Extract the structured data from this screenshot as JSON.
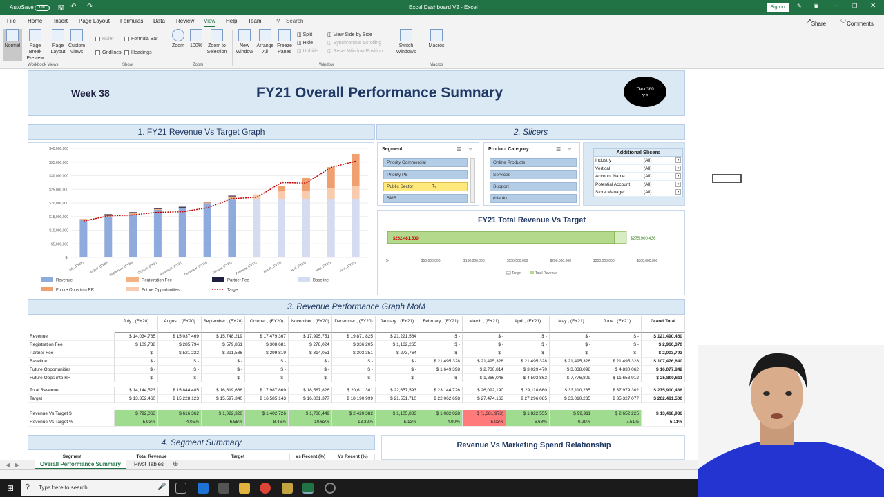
{
  "window": {
    "title": "Excel Dashboard V2 - Excel",
    "autosave": "AutoSave",
    "toggle": "Off",
    "sign_in": "Sign in"
  },
  "menu": {
    "items": [
      "File",
      "Home",
      "Insert",
      "Page Layout",
      "Formulas",
      "Data",
      "Review",
      "View",
      "Help",
      "Team"
    ],
    "search": "Search",
    "share": "Share",
    "comments": "Comments"
  },
  "ribbon": {
    "wb_views": [
      "Normal",
      "Page Break Preview",
      "Page Layout",
      "Custom Views"
    ],
    "show": [
      "Ruler",
      "Formula Bar",
      "Gridlines",
      "Headings"
    ],
    "zoom": [
      "Zoom",
      "100%",
      "Zoom to Selection"
    ],
    "window": [
      "New Window",
      "Arrange All",
      "Freeze Panes"
    ],
    "window_small": [
      "Split",
      "Hide",
      "Unhide"
    ],
    "compare": [
      "View Side by Side",
      "Synchronous Scrolling",
      "Reset Window Position"
    ],
    "switch": "Switch Windows",
    "macros": "Macros",
    "groups": [
      "Workbook Views",
      "Show",
      "Zoom",
      "Window",
      "Macros"
    ]
  },
  "dashboard": {
    "week": "Week 38",
    "title": "FY21 Overall Performance Sumnary",
    "logo_line1": "Data 360",
    "logo_line2": "YP",
    "sec1": "1. FY21 Revenue Vs Target Graph",
    "sec2": "2. Slicers",
    "sec3": "3. Revenue Performance Graph MoM",
    "sec4": "4. Segment Summary",
    "sec5": "Revenue Vs  Marketing Spend Relationship"
  },
  "chart_data": {
    "type": "bar",
    "categories": [
      "July, (FY20)",
      "August, (FY20)",
      "September, (FY20)",
      "October, (FY20)",
      "November, (FY20)",
      "December, (FY20)",
      "January, (FY21)",
      "February, (FY21)",
      "March, (FY21)",
      "April, (FY21)",
      "May, (FY21)",
      "June, (FY21)"
    ],
    "ylim": [
      0,
      40000000
    ],
    "yticks": [
      "$-",
      "$5,000,000",
      "$10,000,000",
      "$15,000,000",
      "$20,000,000",
      "$25,000,000",
      "$30,000,000",
      "$35,000,000",
      "$40,000,000"
    ],
    "series": [
      {
        "name": "Revenue",
        "color": "#8faadc",
        "values": [
          14034785,
          15037469,
          15748219,
          17479367,
          17995751,
          19871825,
          21221564,
          0,
          0,
          0,
          0,
          0
        ]
      },
      {
        "name": "Registration Fee",
        "color": "#f4b183",
        "values": [
          109738,
          285794,
          579861,
          308681,
          278024,
          336205,
          1162265,
          0,
          0,
          0,
          0,
          0
        ]
      },
      {
        "name": "Partner Fee",
        "color": "#1f1f3f",
        "values": [
          0,
          521222,
          291586,
          299819,
          314051,
          303351,
          273764,
          0,
          0,
          0,
          0,
          0
        ]
      },
      {
        "name": "Baseline",
        "color": "#d6dcf0",
        "values": [
          0,
          0,
          0,
          0,
          0,
          0,
          0,
          21495328,
          21495328,
          21495328,
          21495328,
          21495328
        ]
      },
      {
        "name": "Future Opportunities",
        "color": "#f8cbad",
        "values": [
          0,
          0,
          0,
          0,
          0,
          0,
          0,
          1649398,
          2730814,
          3029470,
          3838098,
          4830062
        ]
      },
      {
        "name": "Future Opps into RR",
        "color": "#f0a070",
        "values": [
          0,
          0,
          0,
          0,
          0,
          0,
          0,
          0,
          1866048,
          4593862,
          7776809,
          11653912
        ]
      },
      {
        "name": "Target",
        "color": "#c00000",
        "values": [
          13352460,
          15228123,
          15597340,
          16585143,
          16801377,
          18190999,
          21551710,
          22062698,
          27474163,
          27296085,
          33010235,
          35327077
        ]
      }
    ],
    "legend": [
      "Revenue",
      "Registration Fee",
      "Partner Fee",
      "Baseline",
      "Future Opps into RR",
      "Future Opportunities",
      "Target"
    ]
  },
  "slicers": {
    "segment": {
      "title": "Segment",
      "items": [
        "Priority Commercial",
        "Priority PS",
        "Public Sector",
        "SMB"
      ],
      "selected": 2
    },
    "product": {
      "title": "Product Category",
      "items": [
        "Online Products",
        "Services",
        "Support",
        "(blank)"
      ]
    },
    "additional": {
      "title": "Additional Slicers",
      "rows": [
        [
          "Industry",
          "(All)"
        ],
        [
          "Vertical",
          "(All)"
        ],
        [
          "Account Name",
          "(All)"
        ],
        [
          "Potential Account",
          "(All)"
        ],
        [
          "Store Manager",
          "(All)"
        ]
      ]
    }
  },
  "totalchart": {
    "title": "FY21 Total Revenue Vs Target",
    "bar_label": "$262,481,500",
    "target_label": "$275,900,436",
    "value": 262481500,
    "target": 275900436,
    "ticks": [
      "$-",
      "$50,000,000",
      "$100,000,000",
      "$150,000,000",
      "$200,000,000",
      "$250,000,000",
      "$300,000,000"
    ],
    "legend": [
      "Target",
      "Total Revenue"
    ]
  },
  "table": {
    "headers": [
      "July , (FY20)",
      "August , (FY20)",
      "September , (FY20)",
      "October , (FY20)",
      "November , (FY20)",
      "December , (FY20)",
      "January , (FY21)",
      "February , (FY21)",
      "March , (FY21)",
      "April , (FY21)",
      "May , (FY21)",
      "June , (FY21)",
      "Grand Total"
    ],
    "rows1": [
      [
        "Revenue",
        "$ 14,034,785",
        "$ 15,037,469",
        "$ 15,748,219",
        "$ 17,479,367",
        "$ 17,995,751",
        "$ 19,871,825",
        "$ 21,221,564",
        "$ -",
        "$ -",
        "$ -",
        "$ -",
        "$ -",
        "$ 121,490,460"
      ],
      [
        "Registration Fee",
        "$ 109,738",
        "$ 285,794",
        "$ 579,861",
        "$ 308,681",
        "$ 278,024",
        "$ 336,205",
        "$ 1,162,265",
        "$ -",
        "$ -",
        "$ -",
        "$ -",
        "$ -",
        "$ 2,960,370"
      ],
      [
        "Partner Fee",
        "$ -",
        "$ 521,222",
        "$ 291,586",
        "$ 299,819",
        "$ 314,051",
        "$ 303,351",
        "$ 273,764",
        "$ -",
        "$ -",
        "$ -",
        "$ -",
        "$ -",
        "$ 2,003,793"
      ],
      [
        "Baseline",
        "$ -",
        "$ -",
        "$ -",
        "$ -",
        "$ -",
        "$ -",
        "$ -",
        "$ 21,495,328",
        "$ 21,495,328",
        "$ 21,495,328",
        "$ 21,495,328",
        "$ 21,495,328",
        "$ 107,476,640"
      ],
      [
        "Future Opportunities",
        "$ -",
        "$ -",
        "$ -",
        "$ -",
        "$ -",
        "$ -",
        "$ -",
        "$ 1,649,398",
        "$ 2,730,814",
        "$ 3,029,470",
        "$ 3,838,098",
        "$ 4,830,062",
        "$ 16,077,842"
      ],
      [
        "Future Opps into RR",
        "$ -",
        "$ -",
        "$ -",
        "$ -",
        "$ -",
        "$ -",
        "$ -",
        "$ -",
        "$ 1,866,048",
        "$ 4,593,862",
        "$ 7,776,809",
        "$ 11,653,912",
        "$ 25,890,611"
      ]
    ],
    "rows2": [
      [
        "Total Revenue",
        "$ 14,144,523",
        "$ 15,844,485",
        "$ 16,619,666",
        "$ 17,987,869",
        "$ 18,587,826",
        "$ 20,611,381",
        "$ 22,657,593",
        "$ 23,144,726",
        "$ 26,092,190",
        "$ 29,118,660",
        "$ 33,110,235",
        "$ 37,979,302",
        "$ 275,900,436"
      ],
      [
        "Target",
        "$ 13,352,460",
        "$ 15,228,123",
        "$ 15,597,340",
        "$ 16,585,143",
        "$ 16,801,377",
        "$ 18,190,999",
        "$ 21,551,710",
        "$ 22,062,698",
        "$ 27,474,163",
        "$ 27,296,085",
        "$ 33,010,235",
        "$ 35,327,077",
        "$ 262,481,500"
      ]
    ],
    "rows3": [
      [
        "Revenue Vs Target $",
        "$ 792,063",
        "$ 616,362",
        "$ 1,022,326",
        "$ 1,402,726",
        "$ 1,786,449",
        "$ 2,420,382",
        "$ 1,105,883",
        "$ 1,082,028",
        "$ (1,381,973)",
        "$ 1,822,555",
        "$ 99,911",
        "$ 2,652,225",
        "$ 13,418,936"
      ],
      [
        "Revenue Vs Target %",
        "5.93%",
        "4.05%",
        "6.55%",
        "8.46%",
        "10.63%",
        "13.32%",
        "5.13%",
        "4.90%",
        "-5.03%",
        "6.68%",
        "0.29%",
        "7.51%",
        "5.11%"
      ]
    ],
    "negative_col": 8
  },
  "segment_table": {
    "headers": [
      "Segment",
      "Total Revenue",
      "Target",
      "Vs Recent (%)",
      "Vs Recent (%)"
    ]
  },
  "sheets": [
    "Overall Performance Summary",
    "Pivot Tables"
  ],
  "taskbar": {
    "search": "Type here to search"
  }
}
